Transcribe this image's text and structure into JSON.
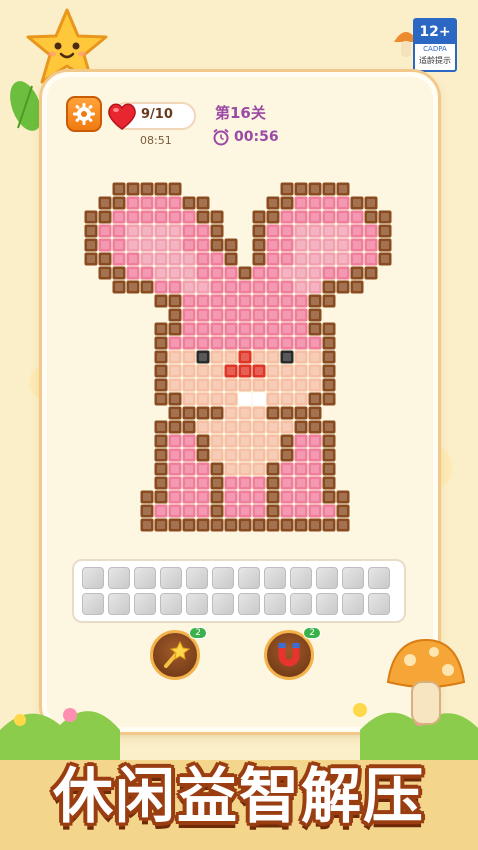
{
  "rating": {
    "age": "12+",
    "org": "CADPA",
    "note": "适龄提示"
  },
  "hud": {
    "lives": "9/10",
    "refill_time": "08:51",
    "level": "第16关",
    "timer": "00:56"
  },
  "board": {
    "legend": {
      "B": "#8a4b20",
      "P": "#f07d9b",
      "K": "#f29fb1",
      "T": "#f6bfa4",
      "D": "#2a2a2a",
      "R": "#e03426",
      "W": "#ffffff"
    },
    "rows": [
      "..BBBBB.......BBBBB...",
      ".BBPPPPBB....BBPPPPBB.",
      "BBPPPPPPBB..BBPPPPPPBB",
      "BPPKKKKPPB..BPPKKKKPPB",
      "BPPKKKKPPBB.BPPKKKKPPB",
      "BBPPKKKKPPB.BPPKKKKPPB",
      ".BBPPKKKPPPBPPKKKPPBB.",
      "..BBBPPKKPPPPPPKKBBB..",
      ".....BBPPPPPPPPPBB....",
      "......BPPPPPPPPPB.....",
      ".....BBPPPPPPPPPBB....",
      ".....BPPPPPPPPPPPB....",
      ".....BTTDTTRTTDTTB....",
      ".....BTTTTRRRTTTTB....",
      ".....BTTTTTTTTTTTB....",
      ".....BBTTTTWWTTTBB....",
      "......BBBBTTTBBBB.....",
      ".....BBBTTTTTTTBBB....",
      ".....BPPBTTTTTBPPB....",
      ".....BPPBTTTTTBPPB....",
      ".....BPPPBTTTBPPPB....",
      ".....BPPPBPPPBPPPB....",
      "....BBPPPBPPPBPPPBB...",
      "....BPPPPBPPPBPPPPB...",
      "....BBBBBBBBBBBBBBB..."
    ]
  },
  "slots": {
    "count": 24
  },
  "tools": [
    {
      "name": "magic-wand",
      "count": "2"
    },
    {
      "name": "magnet",
      "count": "2"
    }
  ],
  "slogan": "休闲益智解压",
  "colors": {
    "accent_orange": "#f07a12",
    "level_purple": "#9b4aa4",
    "badge_green": "#3ab14a",
    "slogan_outline": "#9a3e12"
  }
}
